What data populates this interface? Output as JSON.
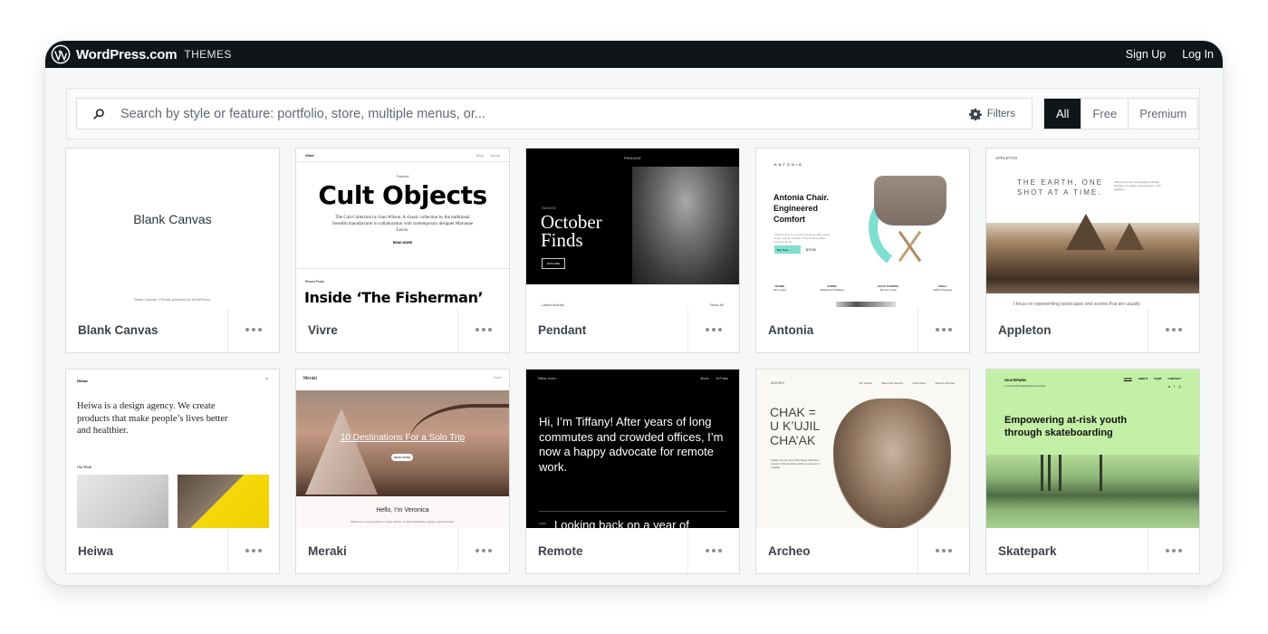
{
  "masthead": {
    "brand_name": "WordPress.com",
    "section": "THEMES",
    "links": [
      {
        "label": "Sign Up"
      },
      {
        "label": "Log In"
      }
    ]
  },
  "search": {
    "placeholder": "Search by style or feature: portfolio, store, multiple menus, or...",
    "value": "",
    "filters_label": "Filters"
  },
  "price_filter": {
    "options": [
      "All",
      "Free",
      "Premium"
    ],
    "selected": "All"
  },
  "colors": {
    "masthead_bg": "#101517",
    "active_filter_bg": "#101517",
    "antonia_accent": "#7fdfd0",
    "skatepark_accent": "#c3f0a6"
  },
  "themes": [
    {
      "name": "Blank Canvas",
      "preview": {
        "title": "Blank Canvas",
        "footer": "Blank Canvas. Proudly powered by WordPress."
      }
    },
    {
      "name": "Vivre",
      "preview": {
        "site": "Vivre",
        "nav": [
          "Blog",
          "About"
        ],
        "kicker": "Featured",
        "headline": "Cult Objects",
        "body": "The Cult Collection by Joan Wilson. A classic collection by the traditional Swedish manufacturer in collaboration with contemporary designer Marianne Lewis.",
        "cta": "READ MORE",
        "section": "Recent Posts",
        "headline2": "Inside ‘The Fisherman’"
      }
    },
    {
      "name": "Pendant",
      "preview": {
        "site": "PENDANT",
        "kicker": "FASHION",
        "headline_line1": "October",
        "headline_line2": "Finds",
        "cta": "EXPLORE",
        "section": "Latest Articles",
        "link": "Read All"
      }
    },
    {
      "name": "Antonia",
      "preview": {
        "site": "ANTONIA",
        "headline": "Antonia Chair. Engineered Comfort",
        "body": "Antonia chair is a comfort focused office guest chair. A great member of the Antonia office furniture family.",
        "cta": "Buy Now →",
        "price": "$79.00",
        "specs": [
          {
            "label": "FRAME",
            "value": "Pine wood"
          },
          {
            "label": "FABRIC",
            "value": "Waterproof Wolfkeg"
          },
          {
            "label": "BACK PADDING",
            "value": "Memory foam"
          },
          {
            "label": "SHELL",
            "value": "100% Polyester"
          }
        ]
      }
    },
    {
      "name": "Appleton",
      "preview": {
        "site": "APPLETON",
        "headline_line1": "THE EARTH, ONE",
        "headline_line2": "SHOT AT A TIME.",
        "intro": "Welcome to the photography portfolio website of a nature photographer, John Appleton.",
        "caption": "I focus on representing landscapes and scenes that are usually"
      }
    },
    {
      "name": "Heiwa",
      "preview": {
        "site": "Heiwa",
        "headline": "Heiwa is a design agency. We create products that make people’s lives better and healthier.",
        "section": "Our Work"
      }
    },
    {
      "name": "Meraki",
      "preview": {
        "site": "Meraki",
        "nav": "Home",
        "headline": "10 Destinations For a Solo Trip",
        "cta": "READ MORE",
        "greeting": "Hello, I’m Veronica",
        "body": "Welcome to my blog where I share stories, in-depth destination guides, and travel tips."
      }
    },
    {
      "name": "Remote",
      "preview": {
        "site": "Tiffany Jones",
        "nav": [
          "About",
          "All Posts"
        ],
        "headline": "Hi, I’m Tiffany! After years of long commutes and crowded offices, I’m now a happy advocate for remote work.",
        "tag": "FEED",
        "headline2": "Looking back on a year of"
      }
    },
    {
      "name": "Archeo",
      "preview": {
        "site": "ARCHEO",
        "nav": [
          "My Travels",
          "Tales from Mexico",
          "Field Notes",
          "Sacred Cenotes"
        ],
        "headline_line1": "CHAK =",
        "headline_line2": "U K’UJIL",
        "headline_line3": "CHA’AK",
        "body": "Chaak, the rain god of the Maya civilization, is seen in this sculpture held in a museum in Yucatán."
      }
    },
    {
      "name": "Skatepark",
      "preview": {
        "site": "SKATEPARK",
        "tagline": "A not-for-profit skateboarding community",
        "nav": [
          "HOME",
          "ABOUT",
          "FAQS",
          "CONTACT"
        ],
        "headline": "Empowering at-risk youth through skateboarding"
      }
    }
  ]
}
